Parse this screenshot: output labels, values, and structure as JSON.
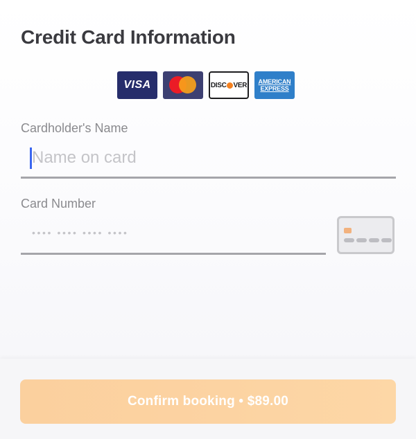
{
  "header": {
    "title": "Credit Card Information"
  },
  "accepted_cards": {
    "visa": "VISA",
    "discover_prefix": "DISC",
    "discover_suffix": "VER",
    "amex_line1": "AMERICAN",
    "amex_line2": "EXPRESS"
  },
  "form": {
    "cardholder": {
      "label": "Cardholder's Name",
      "placeholder": "Name on card",
      "value": ""
    },
    "card_number": {
      "label": "Card Number",
      "placeholder": "•••• •••• •••• ••••",
      "value": ""
    }
  },
  "footer": {
    "confirm_label": "Confirm booking • $89.00"
  },
  "colors": {
    "title": "#3a3a3f",
    "label": "#8a8a8e",
    "caret": "#3a66f0",
    "button_start": "#fbd09e",
    "button_end": "#fdd7a6",
    "visa_bg": "#262d6b",
    "amex_bg": "#2f7fc9"
  },
  "icons": {
    "visa": "visa-logo-icon",
    "mastercard": "mastercard-logo-icon",
    "discover": "discover-logo-icon",
    "amex": "amex-logo-icon",
    "card": "credit-card-icon"
  }
}
